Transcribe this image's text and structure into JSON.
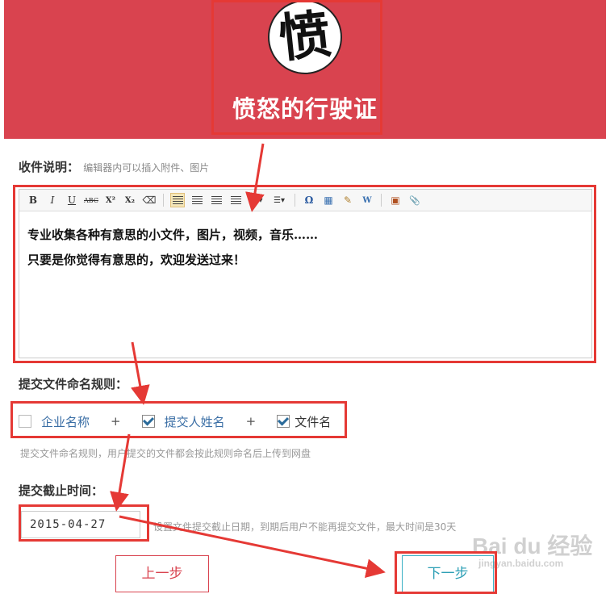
{
  "header": {
    "logo_char": "愤",
    "title": "愤怒的行驶证",
    "bg_color": "#d9434f"
  },
  "collection": {
    "label": "收件说明：",
    "hint": "编辑器内可以插入附件、图片"
  },
  "editor": {
    "toolbar": [
      {
        "name": "bold-icon",
        "glyph": "B"
      },
      {
        "name": "italic-icon",
        "glyph": "I"
      },
      {
        "name": "underline-icon",
        "glyph": "U"
      },
      {
        "name": "strikethrough-icon",
        "glyph": "ABC"
      },
      {
        "name": "superscript-icon",
        "glyph": "X²"
      },
      {
        "name": "subscript-icon",
        "glyph": "X₂"
      },
      {
        "name": "eraser-icon",
        "glyph": "⌫"
      },
      {
        "name": "align-left-icon",
        "glyph": "≡"
      },
      {
        "name": "align-center-icon",
        "glyph": "≡"
      },
      {
        "name": "align-right-icon",
        "glyph": "≡"
      },
      {
        "name": "justify-icon",
        "glyph": "≡"
      },
      {
        "name": "ordered-list-icon",
        "glyph": "⋮▾"
      },
      {
        "name": "unordered-list-icon",
        "glyph": "☰▾"
      },
      {
        "name": "omega-icon",
        "glyph": "Ω"
      },
      {
        "name": "table-icon",
        "glyph": "▦"
      },
      {
        "name": "paint-icon",
        "glyph": "✎"
      },
      {
        "name": "word-icon",
        "glyph": "W"
      },
      {
        "name": "image-icon",
        "glyph": "▣"
      },
      {
        "name": "attachment-icon",
        "glyph": "📎"
      }
    ],
    "line1": "专业收集各种有意思的小文件，图片，视频，音乐……",
    "line2": "只要是你觉得有意思的，欢迎发送过来！"
  },
  "naming": {
    "label": "提交文件命名规则：",
    "options": [
      {
        "label": "企业名称",
        "checked": false
      },
      {
        "label": "提交人姓名",
        "checked": true
      },
      {
        "label": "文件名",
        "checked": true
      }
    ],
    "plus": "+",
    "hint": "提交文件命名规则，用户提交的文件都会按此规则命名后上传到网盘"
  },
  "deadline": {
    "label": "提交截止时间：",
    "value": "2015-04-27",
    "hint": "设置文件提交截止日期，到期后用户不能再提交文件，最大时间是30天"
  },
  "buttons": {
    "prev": "上一步",
    "next": "下一步"
  },
  "watermark": {
    "main": "Bai du 经验",
    "sub": "jingyan.baidu.com"
  }
}
